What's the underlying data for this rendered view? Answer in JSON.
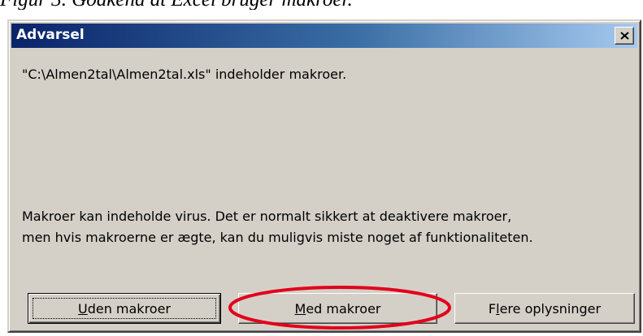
{
  "caption": "Figur 3. Godkend at Excel bruger makroer.",
  "window": {
    "title": "Advarsel",
    "close_label": "Close"
  },
  "message": {
    "path_line": "\"C:\\Almen2tal\\Almen2tal.xls\" indeholder makroer.",
    "warning_line1": "Makroer kan indeholde virus. Det er normalt sikkert at deaktivere makroer,",
    "warning_line2": "men hvis makroerne er ægte, kan du muligvis miste noget af funktionaliteten."
  },
  "buttons": {
    "uden": {
      "mnemonic": "U",
      "rest": "den makroer"
    },
    "med": {
      "mnemonic": "M",
      "rest": "ed makroer"
    },
    "flere": {
      "pre": "F",
      "mnemonic": "l",
      "rest": "ere oplysninger"
    }
  },
  "colors": {
    "dialog_bg": "#d4d0c8",
    "titlebar_start": "#0a246a",
    "titlebar_end": "#a6caf0",
    "highlight": "#e3001b"
  }
}
